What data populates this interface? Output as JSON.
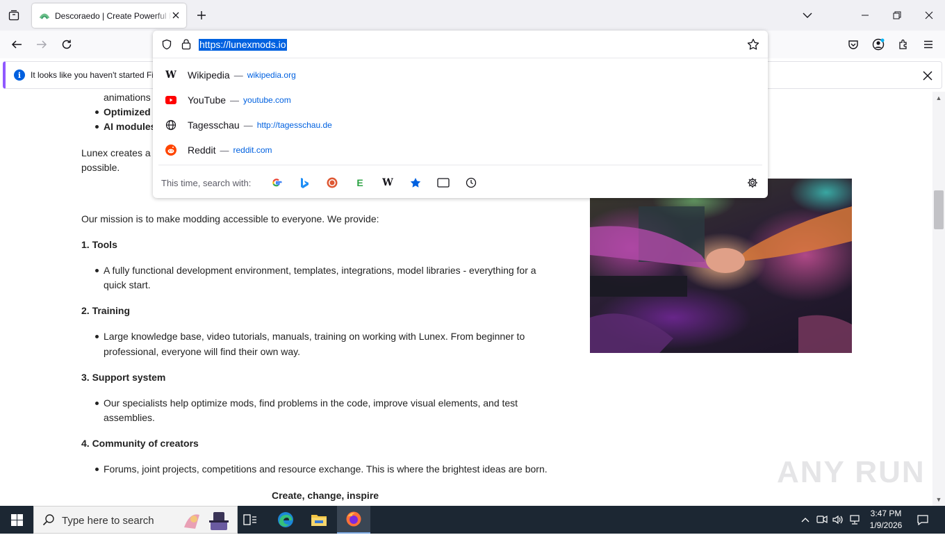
{
  "browser": {
    "tab_title": "Descoraedo | Create Powerful Projects",
    "url": "https://lunexmods.io",
    "notification": "It looks like you haven't started Firefox in a while. Do you want to clean it up for a fresh, like-new experience? And by the way, welcome back!"
  },
  "suggestions": [
    {
      "name": "Wikipedia",
      "link": "wikipedia.org",
      "icon": "wikipedia-icon"
    },
    {
      "name": "YouTube",
      "link": "youtube.com",
      "icon": "youtube-icon"
    },
    {
      "name": "Tagesschau",
      "link": "http://tagesschau.de",
      "icon": "globe-icon"
    },
    {
      "name": "Reddit",
      "link": "reddit.com",
      "icon": "reddit-icon"
    }
  ],
  "search_with_label": "This time, search with:",
  "dash": "—",
  "search_engines": [
    "google-icon",
    "bing-icon",
    "duckduckgo-icon",
    "ebay-icon",
    "wikipedia-icon",
    "bookmarks-icon",
    "tabs-icon",
    "history-icon"
  ],
  "page": {
    "top_fragment": "animations",
    "bullet_optimized": "Optimized",
    "bullet_ai": "AI modules",
    "lunex_fragment": "Lunex creates a",
    "possible": "possible.",
    "mission": "Our mission is to make modding accessible to everyone. We provide:",
    "s1_title": "1. Tools",
    "s1_text1": "A fully functional development environment, templates, integrations, model libraries - everything for a",
    "s1_text2": "quick start.",
    "s2_title": "2. Training",
    "s2_text1": "Large knowledge base, video tutorials, manuals, training on working with Lunex. From beginner to",
    "s2_text2": "professional, everyone will find their own way.",
    "s3_title": "3. Support system",
    "s3_text1": "Our specialists help optimize mods, find problems in the code, improve visual elements, and test",
    "s3_text2": "assemblies.",
    "s4_title": "4. Community of creators",
    "s4_text": "Forums, joint projects, competitions and resource exchange. This is where the brightest ideas are born.",
    "closing": "Create, change, inspire"
  },
  "taskbar": {
    "search_placeholder": "Type here to search",
    "time": "3:47 PM",
    "date": "1/9/2026"
  },
  "watermark": "ANY RUN",
  "colors": {
    "accent": "#0061e0",
    "notice_border": "#9059ff",
    "taskbar": "#1c2733"
  }
}
